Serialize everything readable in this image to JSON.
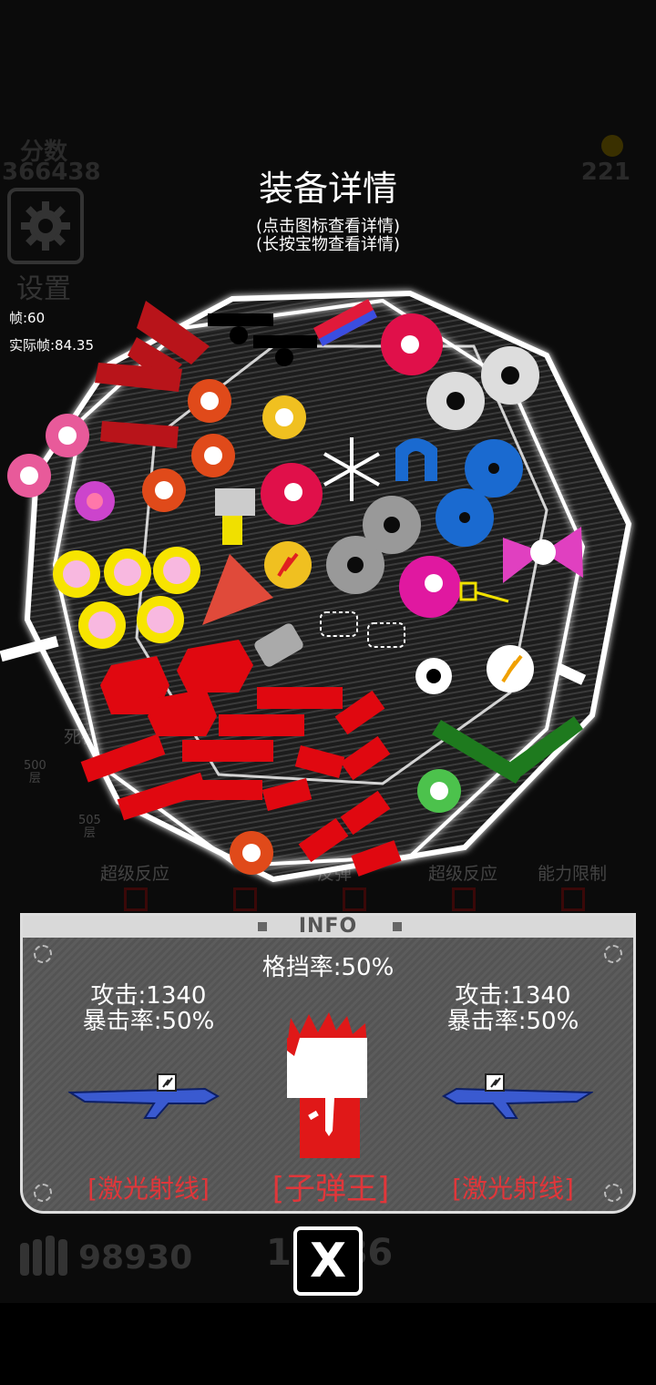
{
  "hud": {
    "score_label": "分数",
    "score": "366438",
    "coins": "221",
    "settings_label": "设置",
    "fps": "帧:60",
    "real_fps": "实际帧:84.35"
  },
  "dialog": {
    "title": "装备详情",
    "hint_tap": "(点击图标查看详情)",
    "hint_hold": "(长按宝物查看详情)"
  },
  "background_labels": {
    "death": "死神",
    "super_reaction_1": "超级反应",
    "reflect": "反弹",
    "super_reaction_2": "超级反应",
    "ability_limit": "能力限制",
    "floor_500": "500\n层",
    "floor_505": "505\n层"
  },
  "info": {
    "title": "INFO",
    "block_rate": "格挡率:50%",
    "left_weapon": {
      "attack": "攻击:1340",
      "crit": "暴击率:50%",
      "name": "[激光射线]"
    },
    "right_weapon": {
      "attack": "攻击:1340",
      "crit": "暴击率:50%",
      "name": "[激光射线]"
    },
    "hero_name": "[子弹王]"
  },
  "bottom": {
    "ammo": "98930",
    "center_value": "10086",
    "close_label": "X"
  },
  "colors": {
    "accent_red": "#e0363a",
    "frame_white": "#ffffff",
    "panel_gray": "#585858"
  }
}
